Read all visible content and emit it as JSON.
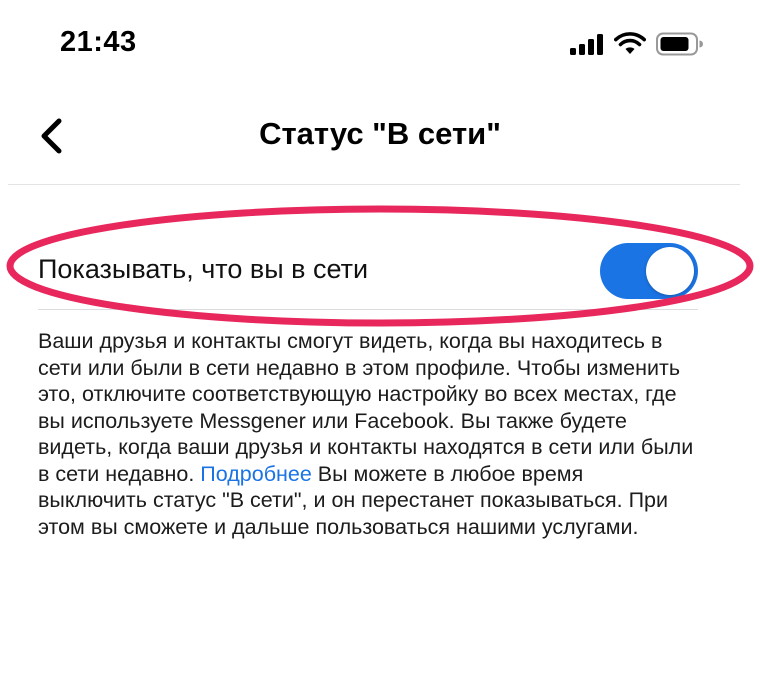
{
  "status_bar": {
    "time": "21:43",
    "icons": [
      "cellular-signal-icon",
      "wifi-icon",
      "battery-icon"
    ]
  },
  "nav": {
    "back_icon": "chevron-left-icon",
    "title": "Статус \"В сети\""
  },
  "setting": {
    "label": "Показывать, что вы в сети",
    "toggle_on": true,
    "toggle_color": "#1b74e4"
  },
  "highlight_color": "#e8285c",
  "description": {
    "text_before": "Ваши друзья и контакты смогут видеть, когда вы находитесь в сети или были в сети недавно в этом профиле. Чтобы изменить это, отключите соответствующую настройку во всех местах, где вы используете Messgener или Facebook. Вы также будете видеть, когда ваши друзья и контакты находятся в сети или были в сети недавно.",
    "link": "Подробнее",
    "text_after": "Вы можете в любое время выключить статус \"В сети\", и он перестанет показываться. При этом вы сможете и дальше пользоваться нашими услугами."
  }
}
